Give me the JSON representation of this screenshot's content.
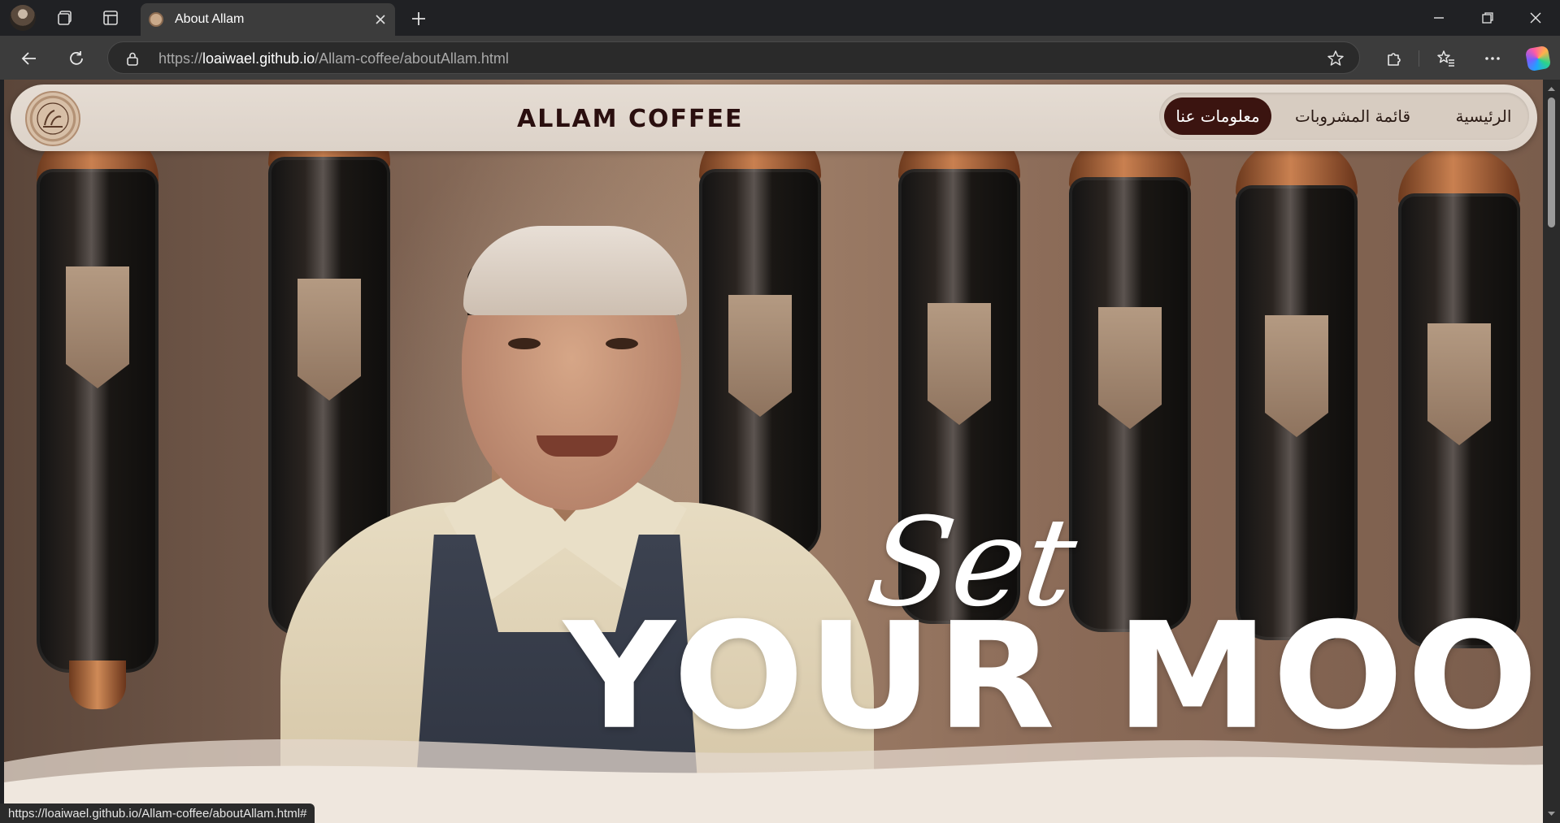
{
  "browser": {
    "tab": {
      "title": "About Allam"
    },
    "url": {
      "host": "loaiwael.github.io",
      "path": "/Allam-coffee/aboutAllam.html",
      "scheme": "https://"
    },
    "status_url": "https://loaiwael.github.io/Allam-coffee/aboutAllam.html#"
  },
  "site": {
    "brand": "ALLAM COFFEE",
    "nav": [
      {
        "label": "الرئيسية",
        "active": false
      },
      {
        "label": "قائمة المشروبات",
        "active": false
      },
      {
        "label": "معلومات عنا",
        "active": true
      }
    ],
    "hero": {
      "script_word": "Set",
      "headline": "YOUR MOOD"
    }
  },
  "colors": {
    "chrome_bg": "#202124",
    "toolbar_bg": "#3c3c3c",
    "header_bg": "#e5dcd3",
    "active_nav_bg": "#3b1410",
    "brand_text": "#2a0f0f"
  },
  "icons": {
    "profile": "profile-avatar",
    "workspaces": "workspaces-icon",
    "tab_actions": "tab-actions-icon",
    "back": "back-arrow-icon",
    "reload": "reload-icon",
    "lock": "lock-icon",
    "favorite": "star-icon",
    "extensions": "puzzle-icon",
    "favorites": "favorites-icon",
    "more": "more-icon",
    "copilot": "copilot-icon"
  }
}
